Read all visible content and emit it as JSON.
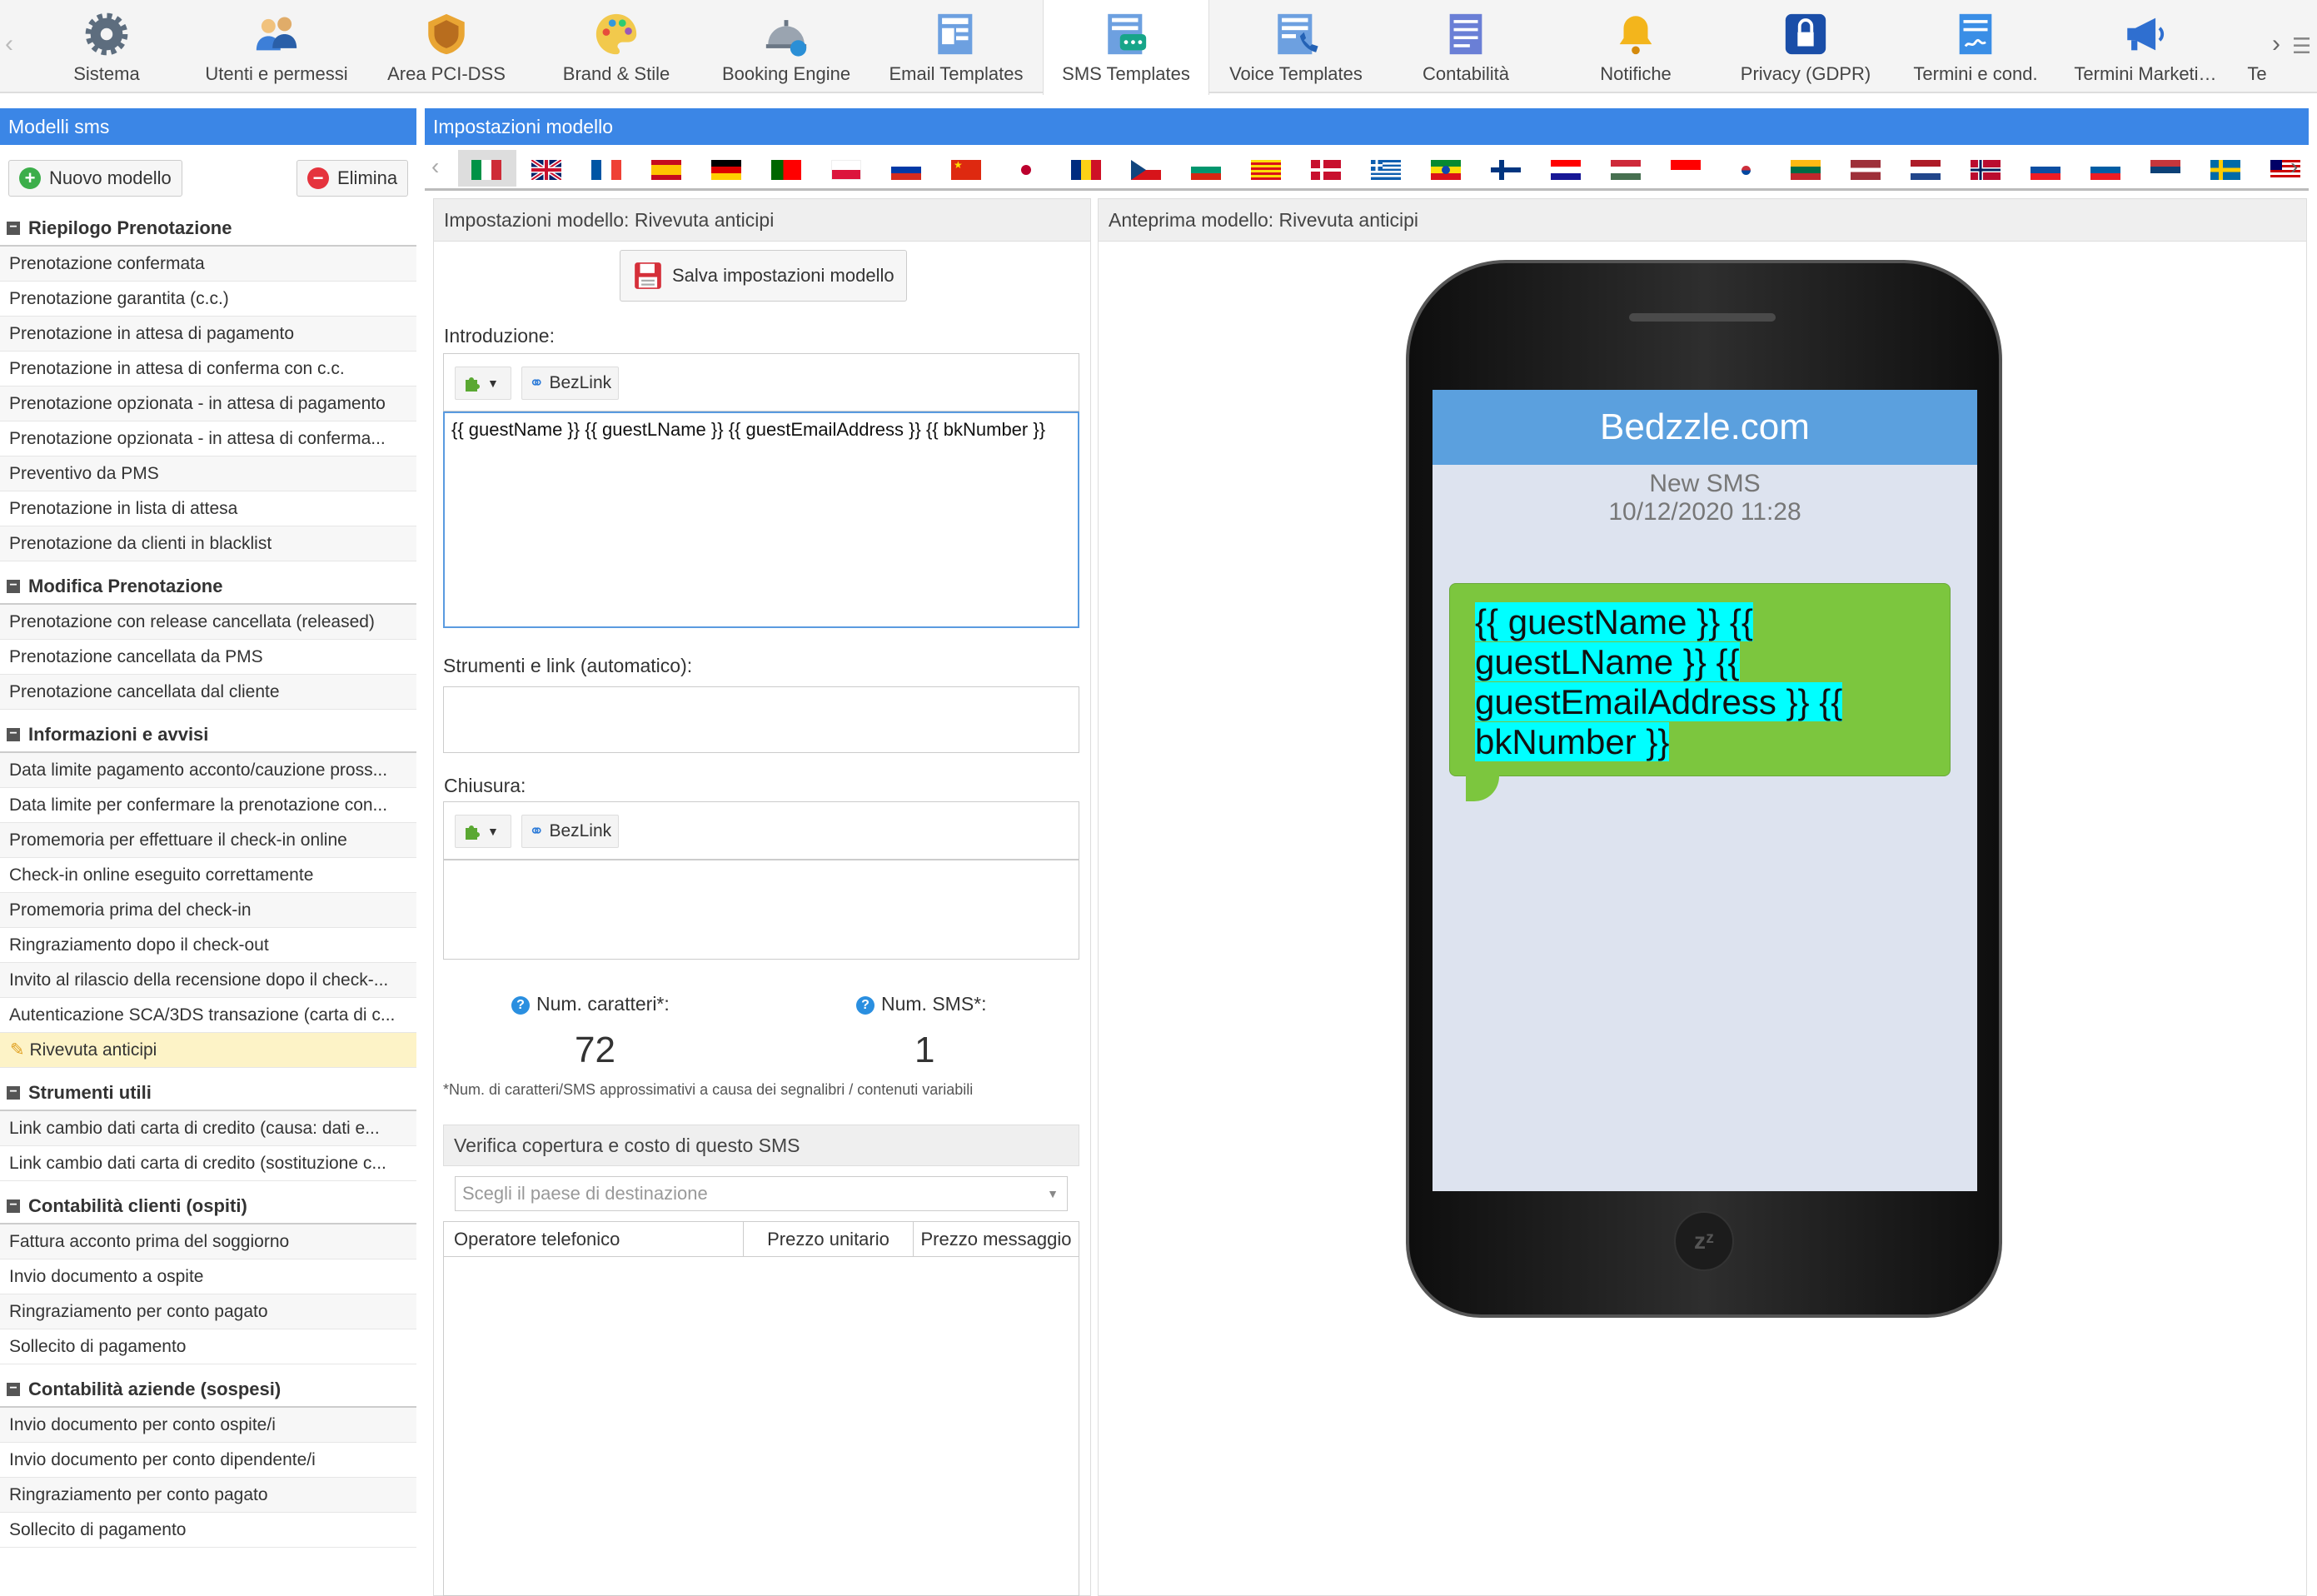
{
  "nav": {
    "items": [
      {
        "label": "Sistema",
        "icon": "gear-icon"
      },
      {
        "label": "Utenti e permessi",
        "icon": "users-icon"
      },
      {
        "label": "Area PCI-DSS",
        "icon": "shield-icon"
      },
      {
        "label": "Brand & Stile",
        "icon": "palette-icon"
      },
      {
        "label": "Booking Engine",
        "icon": "bell-service-icon"
      },
      {
        "label": "Email Templates",
        "icon": "email-template-icon"
      },
      {
        "label": "SMS Templates",
        "icon": "sms-template-icon"
      },
      {
        "label": "Voice Templates",
        "icon": "voice-template-icon"
      },
      {
        "label": "Contabilità",
        "icon": "ledger-icon"
      },
      {
        "label": "Notifiche",
        "icon": "bell-icon"
      },
      {
        "label": "Privacy (GDPR)",
        "icon": "gdpr-lock-icon"
      },
      {
        "label": "Termini e cond.",
        "icon": "document-sign-icon"
      },
      {
        "label": "Termini Marketi…",
        "icon": "megaphone-icon"
      },
      {
        "label": "Te",
        "icon": ""
      }
    ],
    "active_index": 6
  },
  "sidebar": {
    "title": "Modelli sms",
    "new_button": "Nuovo modello",
    "delete_button": "Elimina",
    "sections": [
      {
        "title": "Riepilogo Prenotazione",
        "items": [
          "Prenotazione confermata",
          "Prenotazione garantita (c.c.)",
          "Prenotazione in attesa di pagamento",
          "Prenotazione in attesa di conferma con c.c.",
          "Prenotazione opzionata - in attesa di pagamento",
          "Prenotazione opzionata - in attesa di conferma...",
          "Preventivo da PMS",
          "Prenotazione in lista di attesa",
          "Prenotazione da clienti in blacklist"
        ]
      },
      {
        "title": "Modifica Prenotazione",
        "items": [
          "Prenotazione con release cancellata (released)",
          "Prenotazione cancellata da PMS",
          "Prenotazione cancellata dal cliente"
        ]
      },
      {
        "title": "Informazioni e avvisi",
        "items": [
          "Data limite pagamento acconto/cauzione pross...",
          "Data limite per confermare la prenotazione con...",
          "Promemoria per effettuare il check-in online",
          "Check-in online eseguito correttamente",
          "Promemoria prima del check-in",
          "Ringraziamento dopo il check-out",
          "Invito al rilascio della recensione dopo il check-...",
          "Autenticazione SCA/3DS transazione (carta di c...",
          "Rivevuta anticipi"
        ]
      },
      {
        "title": "Strumenti utili",
        "items": [
          "Link cambio dati carta di credito (causa: dati e...",
          "Link cambio dati carta di credito (sostituzione c..."
        ]
      },
      {
        "title": "Contabilità clienti (ospiti)",
        "items": [
          "Fattura acconto prima del soggiorno",
          "Invio documento a ospite",
          "Ringraziamento per conto pagato",
          "Sollecito di pagamento"
        ]
      },
      {
        "title": "Contabilità aziende (sospesi)",
        "items": [
          "Invio documento per conto ospite/i",
          "Invio documento per conto dipendente/i",
          "Ringraziamento per conto pagato",
          "Sollecito di pagamento"
        ]
      }
    ]
  },
  "main": {
    "title": "Impostazioni modello",
    "flags": [
      "it",
      "gb",
      "fr",
      "es",
      "de",
      "pt",
      "pl",
      "ru",
      "cn",
      "jp",
      "ro",
      "cz",
      "bg",
      "ca",
      "dk",
      "gr",
      "et",
      "fi",
      "hr",
      "hu",
      "id",
      "kr",
      "lt",
      "lv",
      "nl",
      "no",
      "sk",
      "si",
      "rs",
      "se",
      "my"
    ],
    "settings_title": "Impostazioni modello: Rivevuta anticipi",
    "save_button": "Salva impostazioni modello",
    "intro_label": "Introduzione:",
    "bezlink": "BezLink",
    "intro_text": "{{ guestName }} {{ guestLName }} {{ guestEmailAddress }} {{ bkNumber }}",
    "tools_label": "Strumenti e link (automatico):",
    "closing_label": "Chiusura:",
    "chars_label": "Num. caratteri*:",
    "chars_value": "72",
    "sms_label": "Num. SMS*:",
    "sms_value": "1",
    "note": "*Num. di caratteri/SMS approssimativi a causa dei segnalibri / contenuti variabili",
    "coverage_title": "Verifica copertura e costo di questo SMS",
    "country_placeholder": "Scegli il paese di destinazione",
    "table_headers": [
      "Operatore telefonico",
      "Prezzo unitario",
      "Prezzo messaggio"
    ]
  },
  "preview": {
    "title": "Anteprima modello: Rivevuta anticipi",
    "brand": "Bedzzle.com",
    "new_sms": "New SMS",
    "datetime": "10/12/2020 11:28",
    "message": "{{ guestName }} {{ guestLName }} {{ guestEmailAddress }} {{ bkNumber }}"
  }
}
